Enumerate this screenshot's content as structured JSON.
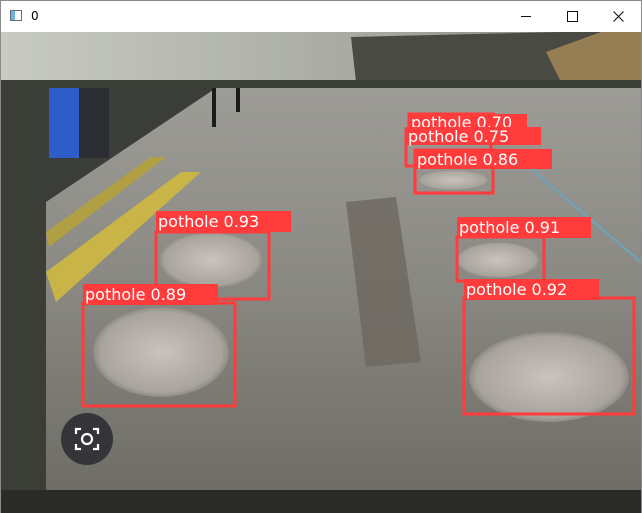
{
  "window": {
    "title": "0",
    "icon": "app-window-icon",
    "controls": [
      "minimize-icon",
      "maximize-icon",
      "close-icon"
    ]
  },
  "overlay": {
    "icon": "lens-scan-icon"
  },
  "colors": {
    "box": "#ff3b3b",
    "label_bg": "#ff3b3b",
    "label_text": "#ffffff"
  },
  "detections": [
    {
      "label": "pothole 0.70"
    },
    {
      "label": "pothole 0.75"
    },
    {
      "label": "pothole 0.86"
    },
    {
      "label": "pothole 0.93"
    },
    {
      "label": "pothole 0.91"
    },
    {
      "label": "pothole 0.89"
    },
    {
      "label": "pothole 0.92"
    }
  ]
}
